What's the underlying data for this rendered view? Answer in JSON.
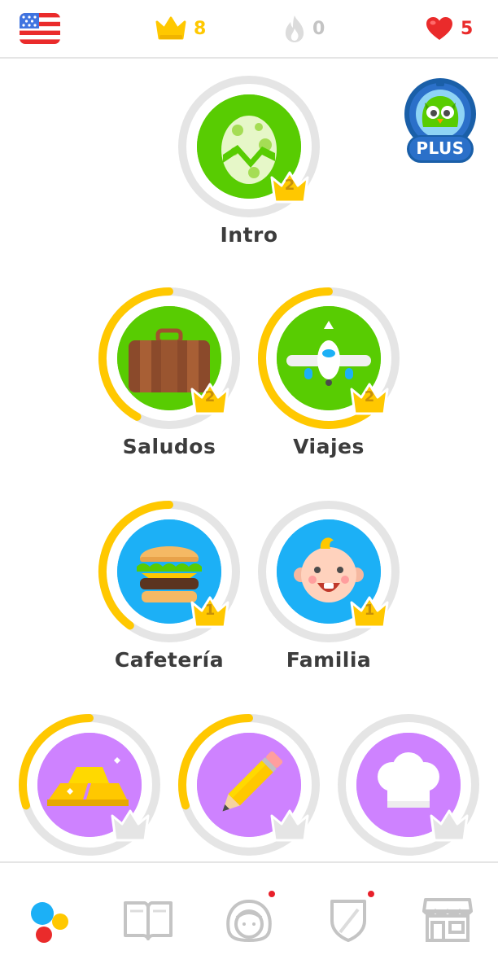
{
  "topbar": {
    "flag_icon": "us-flag-icon",
    "crowns": {
      "icon": "crown-icon",
      "count": "8",
      "color": "#ffc800"
    },
    "streak": {
      "icon": "flame-icon",
      "count": "0",
      "color": "#c4c4c4"
    },
    "hearts": {
      "icon": "heart-icon",
      "count": "5",
      "color": "#ea2b2b"
    }
  },
  "plus_badge": {
    "label": "PLUS",
    "icon": "owl-mascot-icon"
  },
  "skills": [
    {
      "label": "Intro",
      "crown_level": "2",
      "icon": "egg-icon",
      "color": "#58cc02",
      "progress": 0
    },
    {
      "label": "Saludos",
      "crown_level": "2",
      "icon": "suitcase-icon",
      "color": "#58cc02",
      "progress": 0.42
    },
    {
      "label": "Viajes",
      "crown_level": "2",
      "icon": "airplane-icon",
      "color": "#58cc02",
      "progress": 0.6
    },
    {
      "label": "Cafetería",
      "crown_level": "1",
      "icon": "hamburger-icon",
      "color": "#1cb0f6",
      "progress": 0.4
    },
    {
      "label": "Familia",
      "crown_level": "1",
      "icon": "baby-icon",
      "color": "#1cb0f6",
      "progress": 0
    },
    {
      "label": "",
      "crown_level": "",
      "icon": "gold-bars-icon",
      "color": "#ce82ff",
      "progress": 0.3
    },
    {
      "label": "",
      "crown_level": "",
      "icon": "pencil-icon",
      "color": "#ce82ff",
      "progress": 0.3
    },
    {
      "label": "",
      "crown_level": "",
      "icon": "chef-hat-icon",
      "color": "#ce82ff",
      "progress": 0
    }
  ],
  "bottom_nav": [
    {
      "icon": "learn-icon",
      "active": true,
      "notification": false
    },
    {
      "icon": "stories-book-icon",
      "active": false,
      "notification": false
    },
    {
      "icon": "profile-avatar-icon",
      "active": false,
      "notification": true
    },
    {
      "icon": "leagues-shield-icon",
      "active": false,
      "notification": true
    },
    {
      "icon": "shop-icon",
      "active": false,
      "notification": false
    }
  ]
}
